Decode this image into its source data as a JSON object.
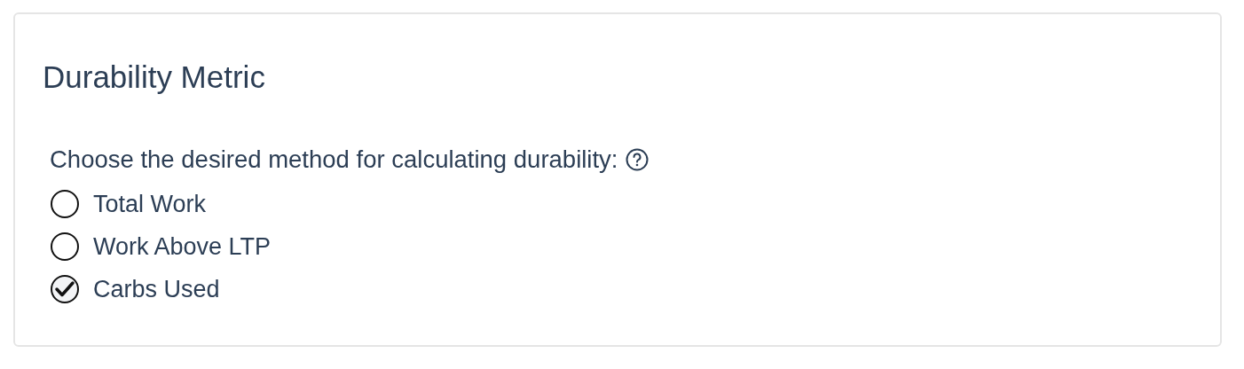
{
  "card": {
    "title": "Durability Metric",
    "question": "Choose the desired method for calculating durability:",
    "options": [
      {
        "label": "Total Work",
        "selected": false
      },
      {
        "label": "Work Above LTP",
        "selected": false
      },
      {
        "label": "Carbs Used",
        "selected": true
      }
    ]
  }
}
